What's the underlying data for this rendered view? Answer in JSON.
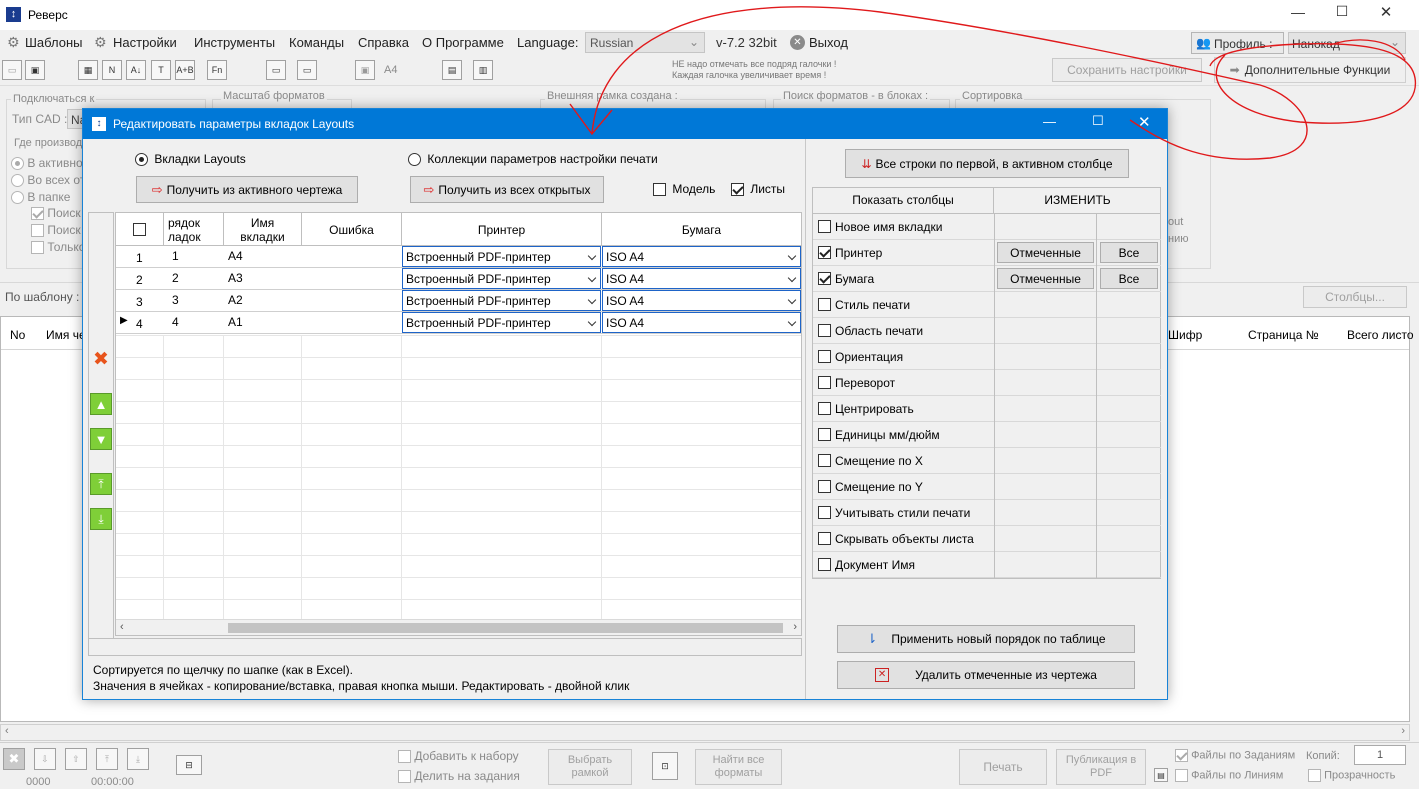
{
  "app": {
    "title": "Реверс",
    "window_controls": [
      "—",
      "☐",
      "✕"
    ]
  },
  "menu": {
    "items": [
      "Шаблоны",
      "Настройки",
      "Инструменты",
      "Команды",
      "Справка",
      "О Программе"
    ],
    "language_label": "Language:",
    "language_value": "Russian",
    "version": "v-7.2 32bit",
    "exit_label": "Выход",
    "profile_label": "Профиль :",
    "profile_value": "Нанокад"
  },
  "toolbar": {
    "icons": [
      "open-icon",
      "save-icon",
      "table-icon",
      "numbering-icon",
      "sort-az-icon",
      "text-icon",
      "ab-icon",
      "fn-icon",
      "frame-a-icon",
      "frame-b-icon",
      "image-icon",
      "a4-icon",
      "grid-a-icon",
      "grid-b-icon"
    ],
    "a4_label": "A4",
    "warning_line1": "НЕ надо отмечать все подряд галочки !",
    "warning_line2": "Каждая галочка увеличивает время !",
    "save_settings_label": "Сохранить настройки",
    "extra_functions_label": "Дополнительные Функции"
  },
  "background": {
    "connect_group": "Подключаться к",
    "cad_type_label": "Тип CAD :",
    "cad_type_value": "Na",
    "scale_group": "Масштаб форматов",
    "frame_group": "Внешняя рамка создана :",
    "search_group": "Поиск форматов - в блоках :",
    "sort_group": "Сортировка",
    "where_group": "Где производ",
    "where_options": [
      "В активном",
      "Во всех от",
      "В папке"
    ],
    "search_options": [
      "Поиск",
      "Поиск",
      "Только"
    ],
    "right_fragments": [
      "out",
      "нию"
    ],
    "template_label": "По шаблону :",
    "columns_button": "Столбцы...",
    "list_headers_left": [
      "No",
      "Имя че"
    ],
    "list_headers_right": [
      "Шифр",
      "Страница №",
      "Всего листо"
    ]
  },
  "dialog": {
    "title": "Редактировать параметры вкладок Layouts",
    "radio_layouts": "Вкладки Layouts",
    "radio_collections": "Коллекции параметров настройки печати",
    "get_active_button": "Получить из активного чертежа",
    "get_all_button": "Получить из всех открытых",
    "model_label": "Модель",
    "sheets_label": "Листы",
    "grid": {
      "headers": {
        "order_line1": "рядок",
        "order_line2": "ладок",
        "name_line1": "Имя",
        "name_line2": "вкладки",
        "error": "Ошибка",
        "printer": "Принтер",
        "paper": "Бумага"
      },
      "rows": [
        {
          "no": "1",
          "order": "1",
          "name": "A4",
          "error": "",
          "printer": "Встроенный PDF-принтер",
          "paper": "ISO A4"
        },
        {
          "no": "2",
          "order": "2",
          "name": "A3",
          "error": "",
          "printer": "Встроенный PDF-принтер",
          "paper": "ISO A4"
        },
        {
          "no": "3",
          "order": "3",
          "name": "A2",
          "error": "",
          "printer": "Встроенный PDF-принтер",
          "paper": "ISO A4"
        },
        {
          "no": "4",
          "order": "4",
          "name": "A1",
          "error": "",
          "printer": "Встроенный PDF-принтер",
          "paper": "ISO A4"
        }
      ]
    },
    "hint_line1": "Сортируется по щелчку по шапке (как в Excel).",
    "hint_line2": "Значения в ячейках - копирование/вставка, правая кнопка мыши. Редактировать - двойной клик",
    "fill_rows_button": "Все строки по первой, в активном столбце",
    "columns_table": {
      "header_show": "Показать столбцы",
      "header_change": "ИЗМЕНИТЬ",
      "marked_label": "Отмеченные",
      "all_label": "Все",
      "items": [
        {
          "label": "Новое имя вкладки",
          "checked": false,
          "editable": false
        },
        {
          "label": "Принтер",
          "checked": true,
          "editable": true
        },
        {
          "label": "Бумага",
          "checked": true,
          "editable": true
        },
        {
          "label": "Стиль печати",
          "checked": false,
          "editable": false
        },
        {
          "label": "Область печати",
          "checked": false,
          "editable": false
        },
        {
          "label": "Ориентация",
          "checked": false,
          "editable": false
        },
        {
          "label": "Переворот",
          "checked": false,
          "editable": false
        },
        {
          "label": "Центрировать",
          "checked": false,
          "editable": false
        },
        {
          "label": "Единицы мм/дюйм",
          "checked": false,
          "editable": false
        },
        {
          "label": "Смещение по X",
          "checked": false,
          "editable": false
        },
        {
          "label": "Смещение по Y",
          "checked": false,
          "editable": false
        },
        {
          "label": "Учитывать стили печати",
          "checked": false,
          "editable": false
        },
        {
          "label": "Скрывать объекты листа",
          "checked": false,
          "editable": false
        },
        {
          "label": "Документ Имя",
          "checked": false,
          "editable": false
        }
      ]
    },
    "apply_order_button": "Применить новый порядок по таблице",
    "delete_marked_button": "Удалить отмеченные из чертежа"
  },
  "bottom": {
    "add_to_set": "Добавить к набору",
    "split_tasks": "Делить на задания",
    "select_frame": "Выбрать рамкой",
    "find_all_formats": "Найти все форматы",
    "print": "Печать",
    "publish_pdf": "Публикация в PDF",
    "files_by_tasks": "Файлы по Заданиям",
    "files_by_lines": "Файлы по Линиям",
    "copies_label": "Копий:",
    "copies_value": "1",
    "transparency": "Прозрачность",
    "counter": "0000",
    "timer": "00:00:00"
  },
  "colors": {
    "dialog_title": "#0078d7",
    "annotation_red": "#e0191b",
    "combo_border": "#1e64c8"
  }
}
